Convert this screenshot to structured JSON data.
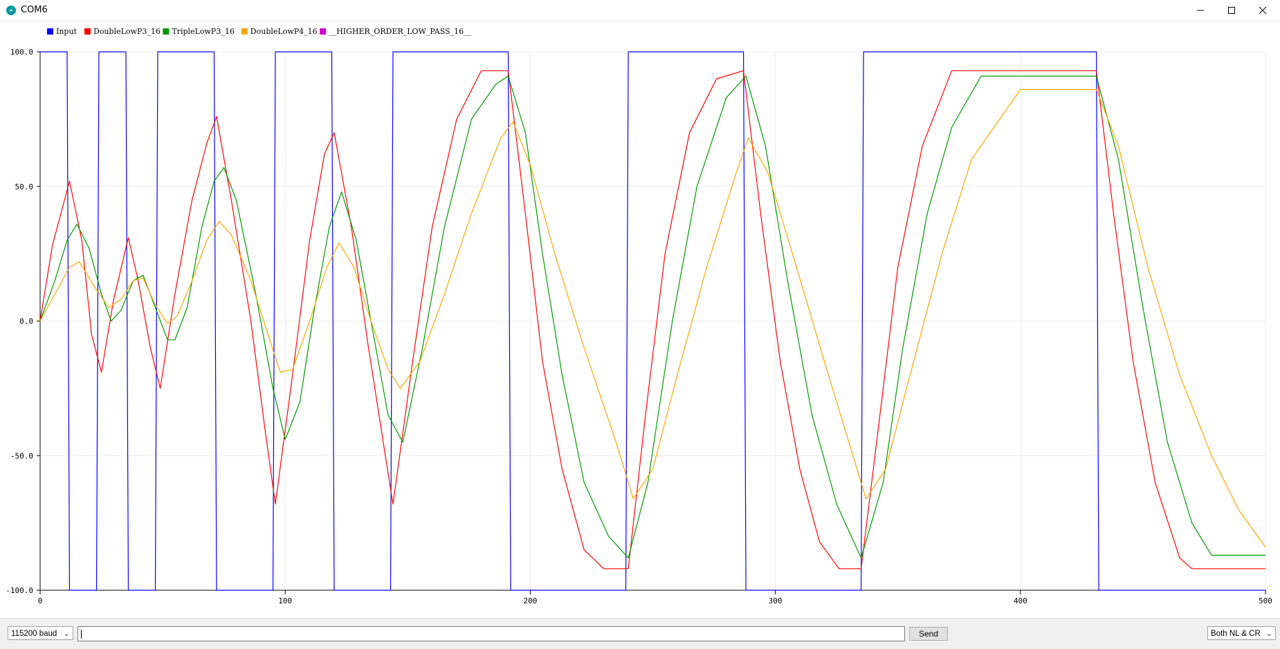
{
  "window": {
    "title": "COM6",
    "app_icon_text": "∞",
    "minimize_icon": "minimize-icon",
    "maximize_icon": "maximize-icon",
    "close_icon": "close-icon"
  },
  "bottom_bar": {
    "baud_rate": "115200 baud",
    "serial_input_value": "",
    "send_label": "Send",
    "line_ending": "Both NL & CR"
  },
  "chart_data": {
    "type": "line",
    "title": "",
    "xlabel": "",
    "ylabel": "",
    "xlim": [
      0,
      500
    ],
    "ylim": [
      -100,
      100
    ],
    "x_ticks": [
      "0",
      "100",
      "200",
      "300",
      "400",
      "500"
    ],
    "y_ticks": [
      "100.0",
      "50.0",
      "0.0",
      "-50.0",
      "-100.0"
    ],
    "grid": true,
    "legend_position": "top-left",
    "series": [
      {
        "name": "Input",
        "color": "#0000ff",
        "points": [
          [
            0,
            100
          ],
          [
            11,
            100
          ],
          [
            12,
            -100
          ],
          [
            23,
            -100
          ],
          [
            24,
            100
          ],
          [
            35,
            100
          ],
          [
            36,
            -100
          ],
          [
            47,
            -100
          ],
          [
            48,
            100
          ],
          [
            71,
            100
          ],
          [
            72,
            -100
          ],
          [
            95,
            -100
          ],
          [
            96,
            100
          ],
          [
            119,
            100
          ],
          [
            120,
            -100
          ],
          [
            143,
            -100
          ],
          [
            144,
            100
          ],
          [
            191,
            100
          ],
          [
            192,
            -100
          ],
          [
            239,
            -100
          ],
          [
            240,
            100
          ],
          [
            287,
            100
          ],
          [
            288,
            -100
          ],
          [
            335,
            -100
          ],
          [
            336,
            100
          ],
          [
            431,
            100
          ],
          [
            432,
            -100
          ],
          [
            500,
            -100
          ]
        ]
      },
      {
        "name": "DoubleLowP3_16",
        "color": "#ff0000",
        "points": [
          [
            0,
            0
          ],
          [
            5,
            28
          ],
          [
            12,
            52
          ],
          [
            17,
            30
          ],
          [
            21,
            -5
          ],
          [
            25,
            -19
          ],
          [
            30,
            8
          ],
          [
            36,
            31
          ],
          [
            40,
            15
          ],
          [
            45,
            -10
          ],
          [
            49,
            -25
          ],
          [
            55,
            10
          ],
          [
            62,
            45
          ],
          [
            68,
            66
          ],
          [
            72,
            76
          ],
          [
            78,
            45
          ],
          [
            86,
            0
          ],
          [
            92,
            -42
          ],
          [
            96,
            -68
          ],
          [
            103,
            -20
          ],
          [
            110,
            30
          ],
          [
            116,
            62
          ],
          [
            120,
            70
          ],
          [
            127,
            35
          ],
          [
            134,
            -10
          ],
          [
            140,
            -45
          ],
          [
            144,
            -68
          ],
          [
            152,
            -15
          ],
          [
            160,
            35
          ],
          [
            170,
            75
          ],
          [
            180,
            93
          ],
          [
            191,
            93
          ],
          [
            198,
            40
          ],
          [
            205,
            -15
          ],
          [
            213,
            -55
          ],
          [
            222,
            -85
          ],
          [
            230,
            -92
          ],
          [
            240,
            -92
          ],
          [
            247,
            -35
          ],
          [
            255,
            25
          ],
          [
            265,
            70
          ],
          [
            276,
            90
          ],
          [
            287,
            93
          ],
          [
            294,
            40
          ],
          [
            302,
            -15
          ],
          [
            310,
            -55
          ],
          [
            318,
            -82
          ],
          [
            326,
            -92
          ],
          [
            335,
            -92
          ],
          [
            342,
            -40
          ],
          [
            350,
            20
          ],
          [
            360,
            65
          ],
          [
            372,
            93
          ],
          [
            431,
            93
          ],
          [
            438,
            40
          ],
          [
            446,
            -15
          ],
          [
            455,
            -60
          ],
          [
            465,
            -88
          ],
          [
            470,
            -92
          ],
          [
            500,
            -92
          ]
        ]
      },
      {
        "name": "TripleLowP3_16",
        "color": "#009900",
        "points": [
          [
            0,
            0
          ],
          [
            6,
            15
          ],
          [
            11,
            30
          ],
          [
            15,
            36
          ],
          [
            20,
            27
          ],
          [
            25,
            10
          ],
          [
            29,
            0
          ],
          [
            33,
            4
          ],
          [
            38,
            15
          ],
          [
            42,
            17
          ],
          [
            47,
            5
          ],
          [
            52,
            -7
          ],
          [
            55,
            -7
          ],
          [
            60,
            5
          ],
          [
            66,
            35
          ],
          [
            71,
            52
          ],
          [
            75,
            57
          ],
          [
            80,
            45
          ],
          [
            88,
            10
          ],
          [
            95,
            -25
          ],
          [
            100,
            -44
          ],
          [
            106,
            -30
          ],
          [
            112,
            5
          ],
          [
            118,
            35
          ],
          [
            123,
            48
          ],
          [
            129,
            30
          ],
          [
            136,
            -5
          ],
          [
            142,
            -35
          ],
          [
            148,
            -45
          ],
          [
            156,
            -10
          ],
          [
            165,
            35
          ],
          [
            176,
            75
          ],
          [
            186,
            88
          ],
          [
            191,
            91
          ],
          [
            198,
            70
          ],
          [
            205,
            25
          ],
          [
            213,
            -20
          ],
          [
            222,
            -60
          ],
          [
            232,
            -80
          ],
          [
            240,
            -88
          ],
          [
            248,
            -60
          ],
          [
            258,
            0
          ],
          [
            268,
            50
          ],
          [
            280,
            83
          ],
          [
            288,
            91
          ],
          [
            296,
            65
          ],
          [
            305,
            15
          ],
          [
            315,
            -35
          ],
          [
            325,
            -68
          ],
          [
            335,
            -88
          ],
          [
            344,
            -60
          ],
          [
            352,
            -10
          ],
          [
            362,
            40
          ],
          [
            372,
            72
          ],
          [
            384,
            91
          ],
          [
            431,
            91
          ],
          [
            440,
            60
          ],
          [
            450,
            5
          ],
          [
            460,
            -45
          ],
          [
            470,
            -75
          ],
          [
            478,
            -87
          ],
          [
            500,
            -87
          ]
        ]
      },
      {
        "name": "DoubleLowP4_16",
        "color": "#ffa500",
        "points": [
          [
            0,
            0
          ],
          [
            6,
            10
          ],
          [
            12,
            20
          ],
          [
            16,
            22
          ],
          [
            22,
            13
          ],
          [
            28,
            5
          ],
          [
            33,
            8
          ],
          [
            38,
            15
          ],
          [
            42,
            16
          ],
          [
            47,
            6
          ],
          [
            52,
            -1
          ],
          [
            56,
            2
          ],
          [
            62,
            15
          ],
          [
            68,
            30
          ],
          [
            73,
            37
          ],
          [
            78,
            32
          ],
          [
            86,
            15
          ],
          [
            93,
            -5
          ],
          [
            98,
            -19
          ],
          [
            103,
            -18
          ],
          [
            110,
            0
          ],
          [
            117,
            20
          ],
          [
            122,
            29
          ],
          [
            128,
            20
          ],
          [
            135,
            0
          ],
          [
            142,
            -18
          ],
          [
            147,
            -25
          ],
          [
            155,
            -15
          ],
          [
            165,
            10
          ],
          [
            176,
            40
          ],
          [
            188,
            68
          ],
          [
            193,
            74
          ],
          [
            200,
            58
          ],
          [
            210,
            25
          ],
          [
            222,
            -10
          ],
          [
            235,
            -45
          ],
          [
            242,
            -66
          ],
          [
            250,
            -55
          ],
          [
            260,
            -20
          ],
          [
            272,
            20
          ],
          [
            284,
            55
          ],
          [
            289,
            68
          ],
          [
            297,
            55
          ],
          [
            307,
            25
          ],
          [
            320,
            -15
          ],
          [
            330,
            -45
          ],
          [
            337,
            -66
          ],
          [
            345,
            -55
          ],
          [
            355,
            -20
          ],
          [
            368,
            25
          ],
          [
            380,
            60
          ],
          [
            400,
            86
          ],
          [
            431,
            86
          ],
          [
            440,
            65
          ],
          [
            452,
            20
          ],
          [
            465,
            -20
          ],
          [
            478,
            -50
          ],
          [
            489,
            -70
          ],
          [
            500,
            -84
          ]
        ]
      },
      {
        "name": "__HIGHER_ORDER_LOW_PASS_16__",
        "color": "#cc00cc",
        "points": []
      }
    ]
  }
}
